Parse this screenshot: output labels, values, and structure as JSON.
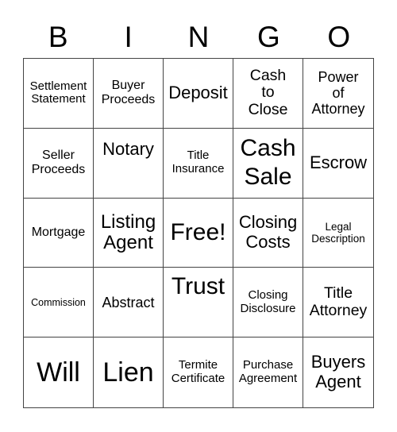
{
  "header": {
    "letters": [
      "B",
      "I",
      "N",
      "G",
      "O"
    ]
  },
  "card": {
    "rows": [
      [
        "Settlement Statement",
        "Buyer Proceeds",
        "Deposit",
        "Cash to Close",
        "Power of Attorney"
      ],
      [
        "Seller Proceeds",
        "Notary",
        "Title Insurance",
        "Cash Sale",
        "Escrow"
      ],
      [
        "Mortgage",
        "Listing Agent",
        "Free!",
        "Closing Costs",
        "Legal Description"
      ],
      [
        "Commission",
        "Abstract",
        "Trust",
        "Closing Disclosure",
        "Title Attorney"
      ],
      [
        "Will",
        "Lien",
        "Termite Certificate",
        "Purchase Agreement",
        "Buyers Agent"
      ]
    ],
    "free_space": "Free!"
  }
}
